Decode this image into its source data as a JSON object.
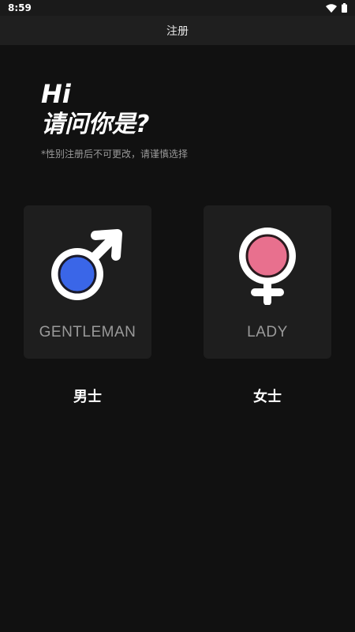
{
  "status_bar": {
    "time": "8:59"
  },
  "header": {
    "title": "注册"
  },
  "greeting": {
    "hi": "Hi",
    "question": "请问你是?",
    "notice": "*性别注册后不可更改，请谨慎选择"
  },
  "options": {
    "male": {
      "card_label": "GENTLEMAN",
      "caption": "男士",
      "accent": "#3a66e8"
    },
    "female": {
      "card_label": "LADY",
      "caption": "女士",
      "accent": "#e8708e"
    }
  },
  "icons": {
    "wifi": "wifi-icon",
    "battery": "battery-icon",
    "male": "male-symbol-icon",
    "female": "female-symbol-icon"
  }
}
